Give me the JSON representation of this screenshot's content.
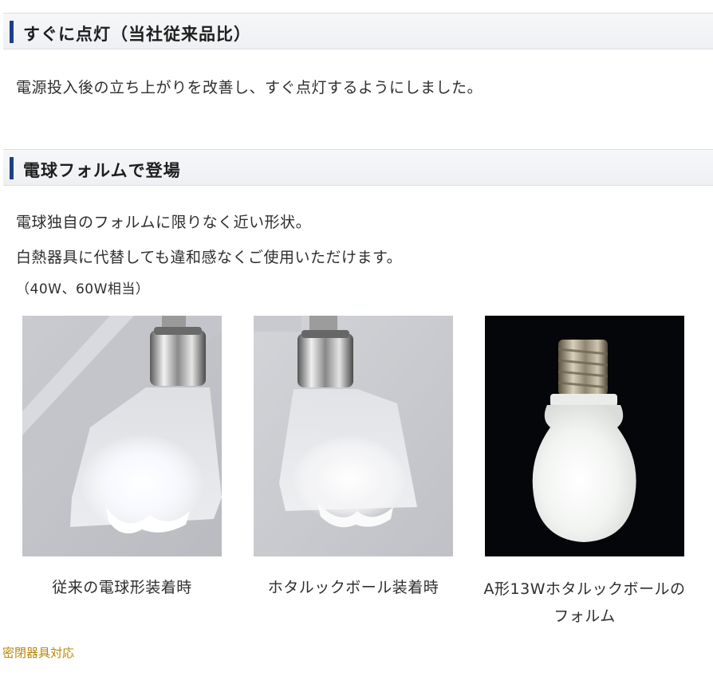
{
  "sections": [
    {
      "heading": "すぐに点灯（当社従来品比）",
      "body": "電源投入後の立ち上がりを改善し、すぐ点灯するようにしました。"
    },
    {
      "heading": "電球フォルムで登場",
      "body_lines": [
        "電球独自のフォルムに限りなく近い形状。",
        "白熱器具に代替しても違和感なくご使用いただけます。",
        "（40W、60W相当）"
      ]
    }
  ],
  "photos": [
    {
      "caption": "従来の電球形装着時"
    },
    {
      "caption": "ホタルックボール装着時"
    },
    {
      "caption_lines": [
        "A形13Wホタルックボールの",
        "フォルム"
      ]
    }
  ],
  "footer": {
    "link_text": "密閉器具対応",
    "link_color": "#b8860b"
  },
  "colors": {
    "accent_bar": "#1d3f8a",
    "header_bg": "#eef0f3"
  }
}
